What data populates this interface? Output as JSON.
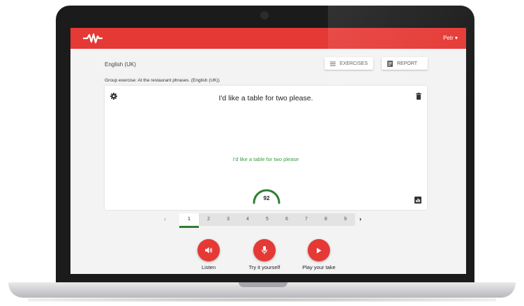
{
  "header": {
    "user": "Petr ▾"
  },
  "page": {
    "language": "English (UK)",
    "exercises_label": "EXERCISES",
    "report_label": "REPORT",
    "group_title": "Group exercise: At the restaurant phrases. (English (UK))"
  },
  "exercise": {
    "target_text": "I'd like a table for two please.",
    "recognized_text": "I'd like a table for two please",
    "score": "92",
    "score_value": 92
  },
  "pager": {
    "prev": "‹",
    "next": "›",
    "pages": [
      "1",
      "2",
      "3",
      "4",
      "5",
      "6",
      "7",
      "8",
      "9"
    ],
    "active_index": 0
  },
  "actions": {
    "listen": "Listen",
    "try": "Try it yourself",
    "play": "Play your take"
  },
  "icons": {
    "logo": "soundwave-logo-icon",
    "exercises": "list-icon",
    "report": "document-icon",
    "gear": "gear-icon",
    "trash": "trash-icon",
    "stats": "bar-chart-icon",
    "listen": "speaker-icon",
    "try": "microphone-icon",
    "play": "play-icon"
  },
  "colors": {
    "brand_red": "#e53935",
    "success_green": "#3d9a40",
    "gauge_green": "#2e7d32"
  }
}
